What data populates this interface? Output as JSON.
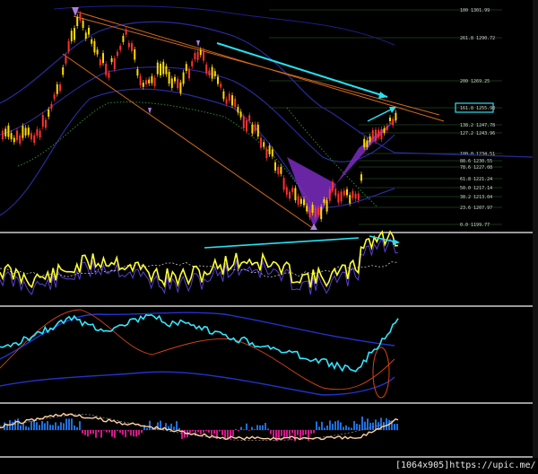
{
  "chart_data": [
    {
      "type": "line",
      "panel": "price",
      "description_free": true,
      "fib_levels": [
        {
          "ratio": "100",
          "price": "1301.99"
        },
        {
          "ratio": "261.8",
          "price": "1290.72"
        },
        {
          "ratio": "200",
          "price": "1269.25"
        },
        {
          "ratio": "161.8",
          "price": "1255.98",
          "highlight": true
        },
        {
          "ratio": "138.2",
          "price": "1247.78"
        },
        {
          "ratio": "127.2",
          "price": "1243.96"
        },
        {
          "ratio": "100.0",
          "price": "1234.51"
        },
        {
          "ratio": "88.6",
          "price": "1230.55"
        },
        {
          "ratio": "78.6",
          "price": "1227.08"
        },
        {
          "ratio": "61.8",
          "price": "1221.24"
        },
        {
          "ratio": "50.0",
          "price": "1217.14"
        },
        {
          "ratio": "38.2",
          "price": "1213.04"
        },
        {
          "ratio": "23.6",
          "price": "1207.97"
        },
        {
          "ratio": "0.0",
          "price": "1199.77"
        }
      ],
      "colors": {
        "bull": "#ffd800",
        "bear": "#ff3030",
        "harmonic": "#7b2cbf",
        "trend": "#d2691e",
        "arrow": "#27e1f0"
      }
    },
    {
      "type": "line",
      "panel": "oscillator-1",
      "colors": {
        "main": "#ffff33",
        "band": "#5a3fd0"
      }
    },
    {
      "type": "line",
      "panel": "oscillator-2",
      "colors": {
        "main": "#33e6ff",
        "band": "#2233cc",
        "aux": "#d84315"
      }
    },
    {
      "type": "bar",
      "panel": "histogram",
      "colors": {
        "pos": "#1e6fe0",
        "neg": "#d01888",
        "line": "#ffd0a0"
      }
    }
  ],
  "watermark": "[1064x905]https://upic.me/"
}
